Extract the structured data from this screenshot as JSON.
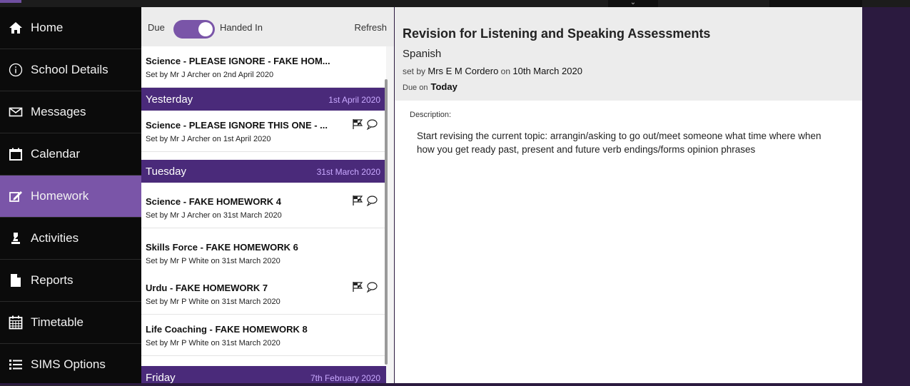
{
  "sidebar": {
    "items": [
      {
        "label": "Home",
        "icon": "home-icon",
        "active": false
      },
      {
        "label": "School Details",
        "icon": "info-icon",
        "active": false
      },
      {
        "label": "Messages",
        "icon": "envelope-icon",
        "active": false
      },
      {
        "label": "Calendar",
        "icon": "calendar-icon",
        "active": false
      },
      {
        "label": "Homework",
        "icon": "pencil-icon",
        "active": true
      },
      {
        "label": "Activities",
        "icon": "chess-piece-icon",
        "active": false
      },
      {
        "label": "Reports",
        "icon": "document-icon",
        "active": false
      },
      {
        "label": "Timetable",
        "icon": "timetable-icon",
        "active": false
      },
      {
        "label": "SIMS Options",
        "icon": "list-icon",
        "active": false
      }
    ]
  },
  "list": {
    "due_label": "Due",
    "handed_in_label": "Handed In",
    "refresh_label": "Refresh",
    "items": [
      {
        "title": "Science - PLEASE IGNORE - FAKE HOM...",
        "subtitle": "Set by Mr J Archer on 2nd April 2020"
      },
      {
        "title": "Science - PLEASE IGNORE THIS ONE - ...",
        "subtitle": "Set by Mr J Archer on 1st April 2020"
      },
      {
        "title": "Science - FAKE HOMEWORK 4",
        "subtitle": "Set by Mr J Archer on 31st March 2020"
      },
      {
        "title": "Skills Force - FAKE HOMEWORK 6",
        "subtitle": "Set by Mr P White on 31st March 2020"
      },
      {
        "title": "Urdu - FAKE HOMEWORK 7",
        "subtitle": "Set by Mr P White on 31st March 2020"
      },
      {
        "title": "Life Coaching - FAKE HOMEWORK 8",
        "subtitle": "Set by Mr P White on 31st March 2020"
      }
    ],
    "separators": [
      {
        "day": "Yesterday",
        "date": "1st April 2020"
      },
      {
        "day": "Tuesday",
        "date": "31st March 2020"
      },
      {
        "day": "Friday",
        "date": "7th February 2020"
      }
    ]
  },
  "detail": {
    "title": "Revision for Listening and Speaking Assessments",
    "subject": "Spanish",
    "set_by_prefix": "set by",
    "teacher": "Mrs E M Cordero",
    "on_word": "on",
    "set_date": "10th March 2020",
    "due_prefix": "Due on",
    "due_value": "Today",
    "description_label": "Description:",
    "description": "Start revising the current topic: arrangin/asking to go out/meet someone what time where when how you get ready past, present and future verb endings/forms opinion phrases"
  },
  "colors": {
    "accent": "#7a55a8",
    "date_separator": "#4a2a7a",
    "sidebar_bg": "#0b0b0b",
    "background": "#2b1a3f"
  }
}
